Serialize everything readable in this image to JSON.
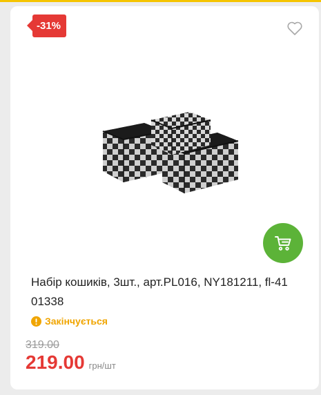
{
  "product": {
    "discount": "-31%",
    "title": "Набір кошиків, 3шт., арт.PL016, NY181211, fl-41 01338",
    "status": "Закінчується",
    "old_price": "319.00",
    "price": "219.00",
    "unit": "грн/шт"
  },
  "icons": {
    "wishlist": "heart-outline-icon",
    "cart": "shopping-cart-icon",
    "status": "exclamation-circle-icon"
  },
  "colors": {
    "accent_top": "#f5c400",
    "badge": "#e53935",
    "price": "#e53935",
    "cart_button": "#5cb338",
    "status": "#f0a500",
    "old_price": "#9a9a9a"
  }
}
